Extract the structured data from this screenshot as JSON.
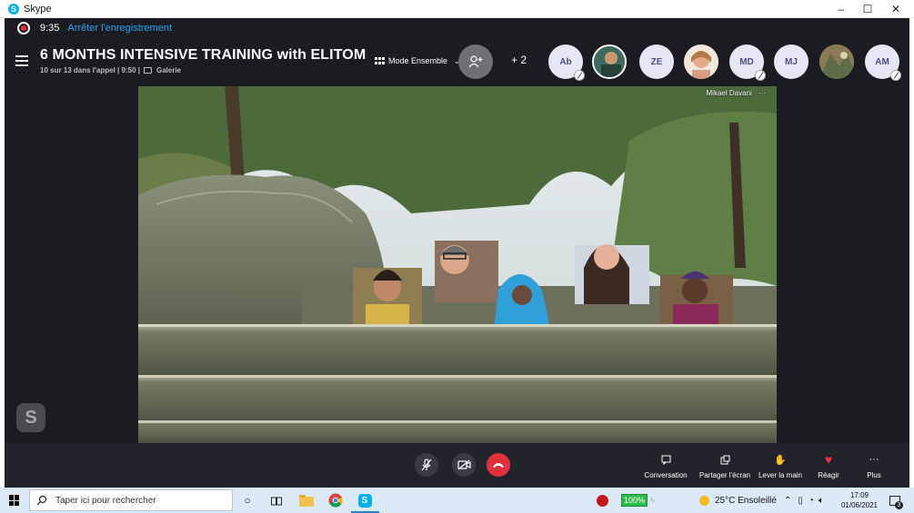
{
  "window": {
    "title": "Skype",
    "minimize_glyph": "–",
    "maximize_glyph": "☐",
    "close_glyph": "✕"
  },
  "recording": {
    "time": "9:35",
    "stop_label": "Arrêter l'enregistrement"
  },
  "call": {
    "title": "6 MONTHS INTENSIVE TRAINING with ELITOM",
    "subtitle": "10 sur 13 dans l'appel | 9:50 |",
    "gallery_label": "Galerie",
    "mode_label": "Mode Ensemble",
    "extra_participants": "+ 2",
    "participants": [
      {
        "initials": "Ab",
        "muted": true
      },
      {
        "initials": "",
        "photo": true,
        "selected": true
      },
      {
        "initials": "ZE",
        "muted": false
      },
      {
        "initials": "",
        "photo": true
      },
      {
        "initials": "MD",
        "muted": true
      },
      {
        "initials": "MJ",
        "muted": false
      },
      {
        "initials": "",
        "photo": true
      },
      {
        "initials": "AM",
        "muted": true
      }
    ]
  },
  "stage": {
    "speaker_name": "Mikael Davani",
    "more_glyph": "···"
  },
  "controls": {
    "conversation": "Conversation",
    "share_screen": "Partager l'écran",
    "raise_hand": "Lever la main",
    "react": "Réagir",
    "more": "Plus"
  },
  "taskbar": {
    "search_placeholder": "Taper ici pour rechercher",
    "battery": "100%",
    "weather": "25°C  Ensoleillé",
    "time": "17:09",
    "date": "01/06/2021",
    "notification_count": "3"
  },
  "colors": {
    "accent": "#2ea3f2",
    "hangup": "#e0313c",
    "recording": "#e3262f",
    "call_bg": "#1b1b22",
    "skype": "#00aff0"
  }
}
